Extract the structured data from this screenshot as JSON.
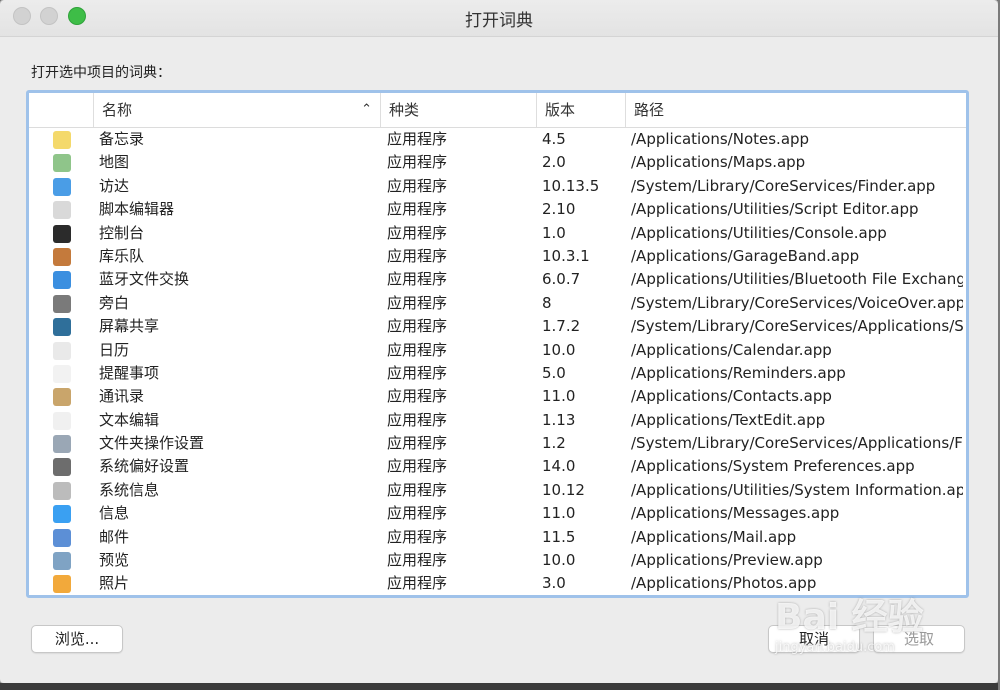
{
  "window": {
    "title": "打开词典"
  },
  "prompt": "打开选中项目的词典：",
  "table": {
    "headers": {
      "name": "名称",
      "kind": "种类",
      "version": "版本",
      "path": "路径"
    },
    "rows": [
      {
        "name": "备忘录",
        "kind": "应用程序",
        "version": "4.5",
        "path": "/Applications/Notes.app",
        "icon": "notes-icon",
        "color": "#f4d96b"
      },
      {
        "name": "地图",
        "kind": "应用程序",
        "version": "2.0",
        "path": "/Applications/Maps.app",
        "icon": "maps-icon",
        "color": "#8fc58a"
      },
      {
        "name": "访达",
        "kind": "应用程序",
        "version": "10.13.5",
        "path": "/System/Library/CoreServices/Finder.app",
        "icon": "finder-icon",
        "color": "#4a9de6"
      },
      {
        "name": "脚本编辑器",
        "kind": "应用程序",
        "version": "2.10",
        "path": "/Applications/Utilities/Script Editor.app",
        "icon": "script-editor-icon",
        "color": "#d9d9d9"
      },
      {
        "name": "控制台",
        "kind": "应用程序",
        "version": "1.0",
        "path": "/Applications/Utilities/Console.app",
        "icon": "console-icon",
        "color": "#2b2b2b"
      },
      {
        "name": "库乐队",
        "kind": "应用程序",
        "version": "10.3.1",
        "path": "/Applications/GarageBand.app",
        "icon": "garageband-icon",
        "color": "#c47a3c"
      },
      {
        "name": "蓝牙文件交换",
        "kind": "应用程序",
        "version": "6.0.7",
        "path": "/Applications/Utilities/Bluetooth File Exchange.app",
        "icon": "bluetooth-icon",
        "color": "#3b8fe0"
      },
      {
        "name": "旁白",
        "kind": "应用程序",
        "version": "8",
        "path": "/System/Library/CoreServices/VoiceOver.app",
        "icon": "voiceover-icon",
        "color": "#7a7a7a"
      },
      {
        "name": "屏幕共享",
        "kind": "应用程序",
        "version": "1.7.2",
        "path": "/System/Library/CoreServices/Applications/Screen Sharing.app",
        "icon": "screen-sharing-icon",
        "color": "#2f6f9a"
      },
      {
        "name": "日历",
        "kind": "应用程序",
        "version": "10.0",
        "path": "/Applications/Calendar.app",
        "icon": "calendar-icon",
        "color": "#e9e9e9"
      },
      {
        "name": "提醒事项",
        "kind": "应用程序",
        "version": "5.0",
        "path": "/Applications/Reminders.app",
        "icon": "reminders-icon",
        "color": "#f2f2f2"
      },
      {
        "name": "通讯录",
        "kind": "应用程序",
        "version": "11.0",
        "path": "/Applications/Contacts.app",
        "icon": "contacts-icon",
        "color": "#c9a56b"
      },
      {
        "name": "文本编辑",
        "kind": "应用程序",
        "version": "1.13",
        "path": "/Applications/TextEdit.app",
        "icon": "textedit-icon",
        "color": "#f0f0f0"
      },
      {
        "name": "文件夹操作设置",
        "kind": "应用程序",
        "version": "1.2",
        "path": "/System/Library/CoreServices/Applications/Folder Actions Setup.app",
        "icon": "folder-actions-icon",
        "color": "#9aa7b5"
      },
      {
        "name": "系统偏好设置",
        "kind": "应用程序",
        "version": "14.0",
        "path": "/Applications/System Preferences.app",
        "icon": "system-preferences-icon",
        "color": "#6d6d6d"
      },
      {
        "name": "系统信息",
        "kind": "应用程序",
        "version": "10.12",
        "path": "/Applications/Utilities/System Information.app",
        "icon": "system-information-icon",
        "color": "#bcbcbc"
      },
      {
        "name": "信息",
        "kind": "应用程序",
        "version": "11.0",
        "path": "/Applications/Messages.app",
        "icon": "messages-icon",
        "color": "#3aa0f2"
      },
      {
        "name": "邮件",
        "kind": "应用程序",
        "version": "11.5",
        "path": "/Applications/Mail.app",
        "icon": "mail-icon",
        "color": "#5c8fd6"
      },
      {
        "name": "预览",
        "kind": "应用程序",
        "version": "10.0",
        "path": "/Applications/Preview.app",
        "icon": "preview-icon",
        "color": "#7fa3c4"
      },
      {
        "name": "照片",
        "kind": "应用程序",
        "version": "3.0",
        "path": "/Applications/Photos.app",
        "icon": "photos-icon",
        "color": "#f2a93b"
      }
    ]
  },
  "buttons": {
    "browse": "浏览...",
    "cancel": "取消",
    "choose": "选取"
  },
  "watermark": {
    "main": "Bai 经验",
    "sub": "jingyan.baidu.com"
  }
}
